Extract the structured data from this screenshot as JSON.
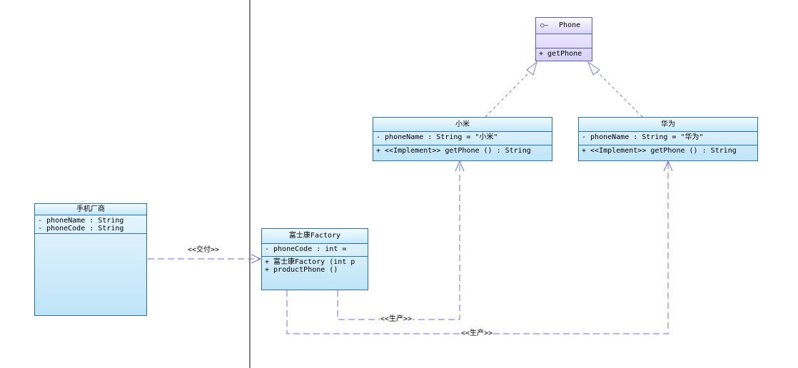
{
  "factory_owner": {
    "name": "手机厂商",
    "attributes": [
      "- phoneName  : String",
      "- phoneCode  : String"
    ]
  },
  "factory": {
    "name": "富士康Factory",
    "attributes": [
      "- phoneCode  : int   ="
    ],
    "operations": [
      "+ 富士康Factory (int p",
      "+ productPhone ()"
    ]
  },
  "phone_interface": {
    "icon": "interface-lollipop-icon",
    "name": "Phone",
    "operations": [
      "+ getPhone"
    ]
  },
  "xiaomi": {
    "name": "小米",
    "attributes": [
      "- phoneName  : String   = \"小米\""
    ],
    "operations": [
      "+ <<Implement>> getPhone ()  : String"
    ]
  },
  "huawei": {
    "name": "华为",
    "attributes": [
      "- phoneName  : String   = \"华为\""
    ],
    "operations": [
      "+ <<Implement>> getPhone ()  : String"
    ]
  },
  "relations": {
    "deliver_label": "<<交付>>",
    "produce_label_1": "<<生产>>",
    "produce_label_2": "<<生产>>"
  },
  "colors": {
    "class_border": "#2a6fa0",
    "interface_border": "#5b59b5",
    "dependency_line": "#6f6fd9",
    "realization_line": "#7b7bd8"
  }
}
